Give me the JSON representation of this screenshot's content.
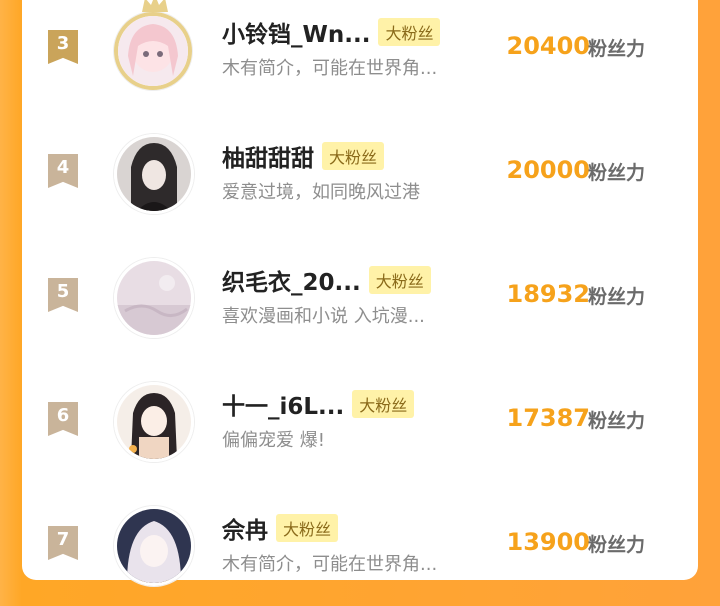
{
  "fans": [
    {
      "rank": "3",
      "name": "小铃铛_Wn...",
      "badge": "大粉丝",
      "bio": "木有简介，可能在世界角...",
      "score": "20400",
      "unit": "粉丝力"
    },
    {
      "rank": "4",
      "name": "柚甜甜甜",
      "badge": "大粉丝",
      "bio": "爱意过境，如同晚风过港",
      "score": "20000",
      "unit": "粉丝力"
    },
    {
      "rank": "5",
      "name": "织毛衣_20...",
      "badge": "大粉丝",
      "bio": "喜欢漫画和小说 入坑漫...",
      "score": "18932",
      "unit": "粉丝力"
    },
    {
      "rank": "6",
      "name": "十一_i6L...",
      "badge": "大粉丝",
      "bio": "偏偏宠爱 爆!",
      "score": "17387",
      "unit": "粉丝力"
    },
    {
      "rank": "7",
      "name": "佘冉",
      "badge": "大粉丝",
      "bio": "木有简介，可能在世界角...",
      "score": "13900",
      "unit": "粉丝力"
    }
  ],
  "colors": {
    "accent": "#f6a21b",
    "badge_bg": "#fff2a8",
    "frame": "#ffa726"
  }
}
